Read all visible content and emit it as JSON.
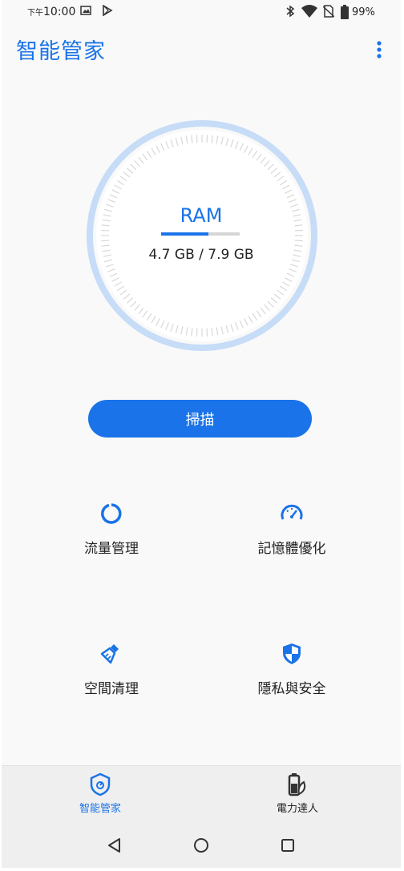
{
  "status_bar": {
    "time_prefix": "下午",
    "time": "10:00",
    "battery": "99%",
    "icons": [
      "image-icon",
      "play-store-icon",
      "bluetooth-icon",
      "wifi-icon",
      "no-sim-icon",
      "battery-icon"
    ]
  },
  "app_bar": {
    "title": "智能管家",
    "menu_icon": "more-vert-icon"
  },
  "ram": {
    "label": "RAM",
    "usage": "4.7 GB / 7.9 GB",
    "used_fraction": 0.6,
    "accent": "#1a73e8",
    "ring_color": "#c6dcf7"
  },
  "scan_button": {
    "label": "掃描"
  },
  "features": [
    {
      "label": "流量管理",
      "icon": "data-usage-icon"
    },
    {
      "label": "記憶體優化",
      "icon": "speedometer-icon"
    },
    {
      "label": "空間清理",
      "icon": "brush-icon"
    },
    {
      "label": "隱私與安全",
      "icon": "shield-icon"
    }
  ],
  "bottom_nav": [
    {
      "label": "智能管家",
      "icon": "mobile-manager-icon",
      "active": true
    },
    {
      "label": "電力達人",
      "icon": "power-master-icon",
      "active": false
    }
  ],
  "system_nav": [
    "back-icon",
    "home-icon",
    "recents-icon"
  ],
  "colors": {
    "accent": "#1a73e8",
    "text": "#222222",
    "background": "#f9f9f9"
  }
}
